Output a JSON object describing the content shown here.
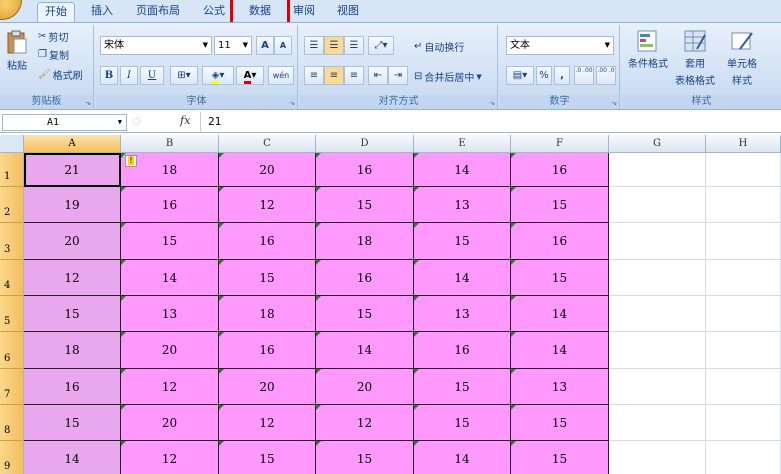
{
  "tabs": [
    {
      "label": "开始"
    },
    {
      "label": "插入"
    },
    {
      "label": "页面布局"
    },
    {
      "label": "公式"
    },
    {
      "label": "数据"
    },
    {
      "label": "审阅"
    },
    {
      "label": "视图"
    }
  ],
  "clipboard": {
    "paste": "粘贴",
    "cut": "剪切",
    "copy": "复制",
    "format_painter": "格式刷",
    "group": "剪贴板"
  },
  "font": {
    "name": "宋体",
    "size": "11",
    "grow": "A",
    "shrink": "A",
    "bold": "B",
    "italic": "I",
    "underline": "U",
    "color_letter": "A",
    "pinyin": "wén",
    "group": "字体"
  },
  "alignment": {
    "wrap": "自动换行",
    "merge": "合并后居中",
    "group": "对齐方式"
  },
  "number": {
    "format": "文本",
    "percent": "%",
    "comma": ",",
    "inc_dec": ".0 .00",
    "dec_dec": ".00 .0",
    "group": "数字"
  },
  "styles": {
    "cond": "条件格式",
    "table1": "套用",
    "table2": "表格格式",
    "cell1": "单元格",
    "cell2": "样式",
    "group": "样式"
  },
  "formula_bar": {
    "cell_ref": "A1",
    "fx": "fx",
    "value": "21"
  },
  "columns": [
    "A",
    "B",
    "C",
    "D",
    "E",
    "F",
    "G",
    "H"
  ],
  "rows": [
    {
      "num": "1",
      "cells": [
        "21",
        "18",
        "20",
        "16",
        "14",
        "16"
      ]
    },
    {
      "num": "2",
      "cells": [
        "19",
        "16",
        "12",
        "15",
        "13",
        "15"
      ]
    },
    {
      "num": "3",
      "cells": [
        "20",
        "15",
        "16",
        "18",
        "15",
        "16"
      ]
    },
    {
      "num": "4",
      "cells": [
        "12",
        "14",
        "15",
        "16",
        "14",
        "15"
      ]
    },
    {
      "num": "5",
      "cells": [
        "15",
        "13",
        "18",
        "15",
        "13",
        "14"
      ]
    },
    {
      "num": "6",
      "cells": [
        "18",
        "20",
        "16",
        "14",
        "16",
        "14"
      ]
    },
    {
      "num": "7",
      "cells": [
        "16",
        "12",
        "20",
        "20",
        "15",
        "13"
      ]
    },
    {
      "num": "8",
      "cells": [
        "15",
        "20",
        "12",
        "12",
        "15",
        "15"
      ]
    },
    {
      "num": "9",
      "cells": [
        "14",
        "12",
        "15",
        "15",
        "14",
        "15"
      ]
    }
  ],
  "colors": {
    "fill": "#ff99ff",
    "fill_selected": "#e9a8ee",
    "highlight": "#e00000"
  }
}
